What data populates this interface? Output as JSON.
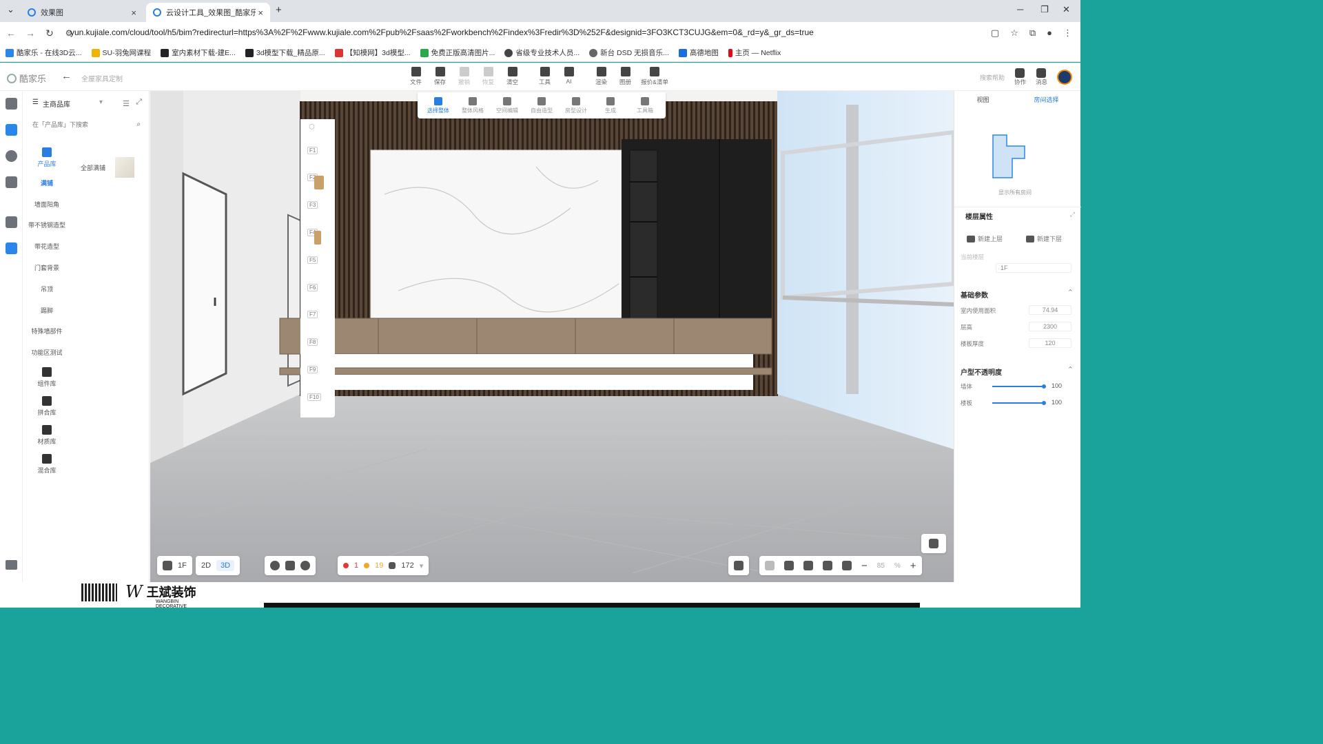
{
  "browser": {
    "tabs": [
      {
        "title": "效果图",
        "active": false
      },
      {
        "title": "云设计工具_效果图_酷家乐作业",
        "active": true
      }
    ],
    "new_tab": "+",
    "url": "yun.kujiale.com/cloud/tool/h5/bim?redirecturl=https%3A%2F%2Fwww.kujiale.com%2Fpub%2Fsaas%2Fworkbench%2Findex%3Fredir%3D%252F&designid=3FO3KCT3CUJG&em=0&_rd=y&_gr_ds=true",
    "bookmarks": [
      {
        "label": "酷家乐 - 在线3D云...",
        "color": "#2a86e8"
      },
      {
        "label": "SU-羽兔网课程",
        "color": "#f0b400"
      },
      {
        "label": "室内素材下载-建E...",
        "color": "#222"
      },
      {
        "label": "3d模型下载_精品原...",
        "color": "#222"
      },
      {
        "label": "【知模网】3d模型...",
        "color": "#d33"
      },
      {
        "label": "免费正版高清图片...",
        "color": "#2aa84a"
      },
      {
        "label": "省级专业技术人员...",
        "color": "#444"
      },
      {
        "label": "新台 DSD 无损音乐...",
        "color": "#666"
      },
      {
        "label": "高德地图",
        "color": "#1a6de0"
      },
      {
        "label": "主页 — Netflix",
        "color": "#e50914"
      }
    ]
  },
  "app": {
    "logo": "酷家乐",
    "project_name": "全屋家具定制",
    "toolbar": [
      {
        "label": "文件",
        "dim": false
      },
      {
        "label": "保存",
        "dim": false
      },
      {
        "label": "撤销",
        "dim": true
      },
      {
        "label": "恢复",
        "dim": true
      },
      {
        "label": "清空",
        "dim": false
      },
      {
        "label": "工具",
        "dim": false
      },
      {
        "label": "AI",
        "dim": false
      },
      {
        "label": "渲染",
        "dim": false
      },
      {
        "label": "图册",
        "dim": false
      },
      {
        "label": "报价&清单",
        "dim": false
      }
    ],
    "search_help": "搜索帮助",
    "header_items": [
      {
        "label": "协作"
      },
      {
        "label": "消息"
      }
    ]
  },
  "library": {
    "title": "主商品库",
    "search_placeholder": "在「产品库」下搜索",
    "nav_top": {
      "label": "产品库"
    },
    "categories": [
      {
        "label": "满铺",
        "active": true
      },
      {
        "label": "墙面阳角",
        "active": false
      },
      {
        "label": "带不锈钢造型",
        "active": false
      },
      {
        "label": "带花造型",
        "active": false
      },
      {
        "label": "门套背景",
        "active": false
      },
      {
        "label": "吊顶",
        "active": false
      },
      {
        "label": "踢脚",
        "active": false
      },
      {
        "label": "特殊墙部件",
        "active": false
      },
      {
        "label": "功能区测试",
        "active": false
      }
    ],
    "nav_bottom": [
      {
        "label": "组件库"
      },
      {
        "label": "拼合库"
      },
      {
        "label": "材质库"
      },
      {
        "label": "混合库"
      }
    ],
    "item": {
      "label": "全部满铺"
    }
  },
  "floors": [
    "F1",
    "F2",
    "F3",
    "F4",
    "F5",
    "F6",
    "F7",
    "F8",
    "F9",
    "F10"
  ],
  "modes": [
    {
      "label": "选择整体",
      "active": true
    },
    {
      "label": "整体风格",
      "active": false
    },
    {
      "label": "空间编辑",
      "active": false
    },
    {
      "label": "自由造型",
      "active": false
    },
    {
      "label": "房型设计",
      "active": false
    },
    {
      "label": "生成",
      "active": false
    },
    {
      "label": "工具箱",
      "active": false
    }
  ],
  "bottom_bar": {
    "floor": "1F",
    "view2d": "2D",
    "view3d": "3D",
    "errors": "1",
    "warnings": "19",
    "count": "172",
    "zoom": "85",
    "zoom_unit": "%"
  },
  "right_panel": {
    "tabs": [
      {
        "label": "视图",
        "active": false
      },
      {
        "label": "房间选择",
        "active": true
      }
    ],
    "thumb_caption": "显示所有房间",
    "layer_title": "楼层属性",
    "btn_add_up": "新建上层",
    "btn_add_down": "新建下层",
    "current_floor_label": "当前楼层",
    "current_floor_value": "1F",
    "basic_title": "基础参数",
    "params": [
      {
        "label": "室内使用面积",
        "value": "74.94"
      },
      {
        "label": "层高",
        "value": "2300"
      },
      {
        "label": "楼板厚度",
        "value": "120"
      }
    ],
    "opacity_title": "户型不透明度",
    "opacity": [
      {
        "label": "墙体",
        "value": "100"
      },
      {
        "label": "楼板",
        "value": "100"
      }
    ]
  },
  "footer": {
    "brand_cn": "王斌装饰",
    "brand_en": "WANGBIN DECORATIVE"
  }
}
